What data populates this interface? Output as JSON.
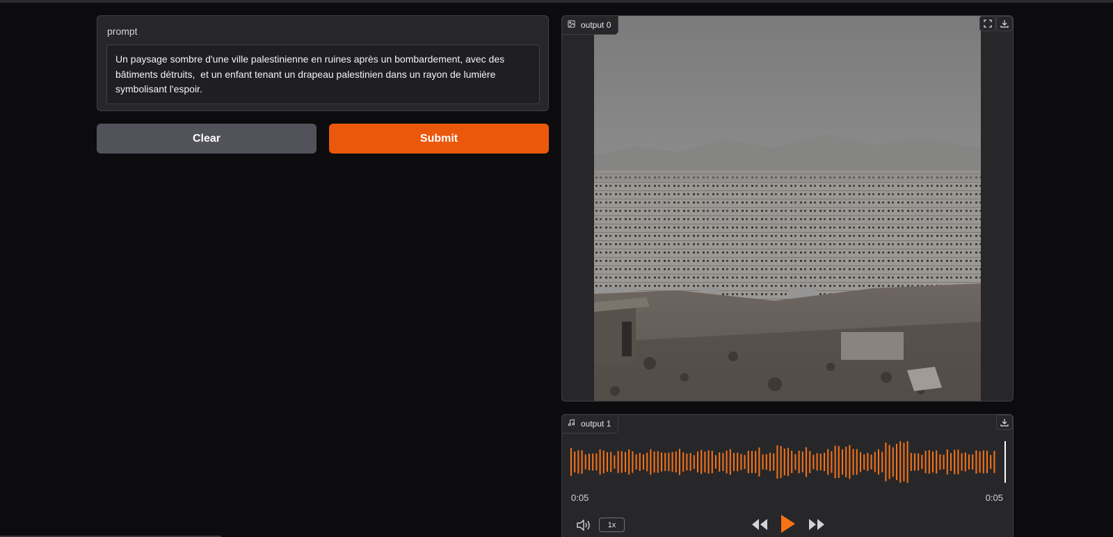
{
  "prompt": {
    "label": "prompt",
    "value": "Un paysage sombre d'une ville palestinienne en ruines après un bombardement, avec des bâtiments détruits,  et un enfant tenant un drapeau palestinien dans un rayon de lumière symbolisant l'espoir."
  },
  "buttons": {
    "clear_label": "Clear",
    "submit_label": "Submit"
  },
  "output0": {
    "label": "output 0",
    "icon": "image-icon",
    "tools": [
      "fullscreen-icon",
      "download-icon"
    ]
  },
  "output1": {
    "label": "output 1",
    "icon": "music-icon",
    "tools": [
      "download-icon"
    ],
    "current_time": "0:05",
    "duration": "0:05",
    "speed": "1x",
    "progress": 1.0
  },
  "colors": {
    "accent": "#ea580c",
    "waveform": "#f97316",
    "background": "#0c0c0f",
    "panel": "#27272a",
    "clear_button": "#52525b"
  }
}
